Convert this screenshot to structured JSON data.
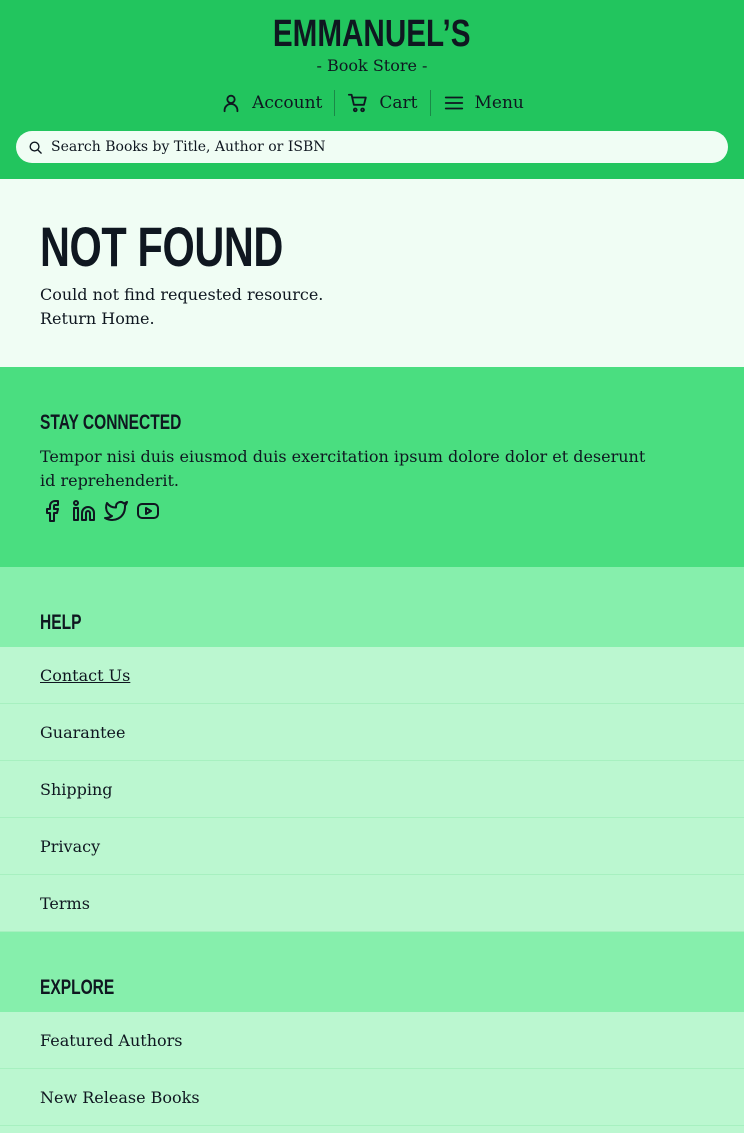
{
  "header": {
    "logo_title": "EMMANUEL’S",
    "logo_subtitle": "- Book Store -",
    "nav": [
      {
        "label": "Account",
        "icon": "user-icon"
      },
      {
        "label": "Cart",
        "icon": "cart-icon"
      },
      {
        "label": "Menu",
        "icon": "menu-icon"
      }
    ],
    "search": {
      "placeholder": "Search Books by Title, Author or ISBN",
      "value": ""
    }
  },
  "not_found": {
    "title": "NOT FOUND",
    "message": "Could not find requested resource.",
    "link": "Return Home."
  },
  "connected": {
    "heading": "STAY CONNECTED",
    "text": "Tempor nisi duis eiusmod duis exercitation ipsum dolore dolor et deserunt id reprehenderit.",
    "social": [
      "facebook-icon",
      "linkedin-icon",
      "twitter-icon",
      "youtube-icon"
    ]
  },
  "help": {
    "heading": "HELP",
    "items": [
      "Contact Us",
      "Guarantee",
      "Shipping",
      "Privacy",
      "Terms"
    ]
  },
  "explore": {
    "heading": "EXPLORE",
    "items": [
      "Featured Authors",
      "New Release Books"
    ]
  },
  "colors": {
    "header": "#22c55e",
    "page": "#f0fdf4",
    "connected": "#4ade80",
    "list_head": "#86efac",
    "list_item": "#bbf7d0",
    "text": "#0f1720"
  }
}
